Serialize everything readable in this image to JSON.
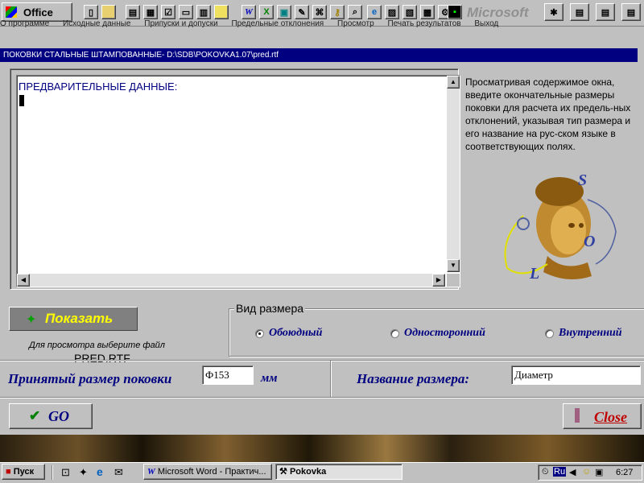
{
  "office_bar": {
    "label": "Office",
    "brand": "Microsoft"
  },
  "menu": [
    "О программе",
    "Исходные данные",
    "Припуски и допуски",
    "Предельные отклонения",
    "Просмотр",
    "Печать результатов",
    "Выход"
  ],
  "window": {
    "title": "ПОКОВКИ СТАЛЬНЫЕ ШТАМПОВАННЫЕ- D:\\SDB\\POKOVKA1.07\\pred.rtf"
  },
  "document": {
    "text": "ПРЕДВАРИТЕЛЬНЫЕ ДАННЫЕ:"
  },
  "help": {
    "text": "Просматривая содержимое окна, введите окончательные размеры поковки для расчета их предель-ных отклонений, указывая тип размера и его название на рус-ском языке в соответствующих полях."
  },
  "logo": {
    "letters": [
      "S",
      "O",
      "L"
    ]
  },
  "show_button": {
    "label": "Показать"
  },
  "file_hint": {
    "label": "Для просмотра выберите файл",
    "filename": "PRED.RTF"
  },
  "size_type": {
    "legend": "Вид размера",
    "options": [
      {
        "label": "Обоюдный",
        "selected": true
      },
      {
        "label": "Односторонний",
        "selected": false
      },
      {
        "label": "Внутренний",
        "selected": false
      }
    ]
  },
  "accepted_size": {
    "label": "Принятый размер поковки",
    "value": "Ф153",
    "unit": "мм"
  },
  "size_name": {
    "label": "Название размера:",
    "value": "Диаметр"
  },
  "go_button": {
    "label": "GO"
  },
  "close_button": {
    "label": "Close"
  },
  "taskbar": {
    "start": "Пуск",
    "tasks": [
      "Microsoft Word - Практич...",
      "Pokovka"
    ],
    "lang": "Ru",
    "clock": "6:27"
  },
  "colors": {
    "title_bar": "#000080",
    "accent_yellow": "#ffff00",
    "label_blue": "#000080",
    "close_red": "#c00000"
  }
}
